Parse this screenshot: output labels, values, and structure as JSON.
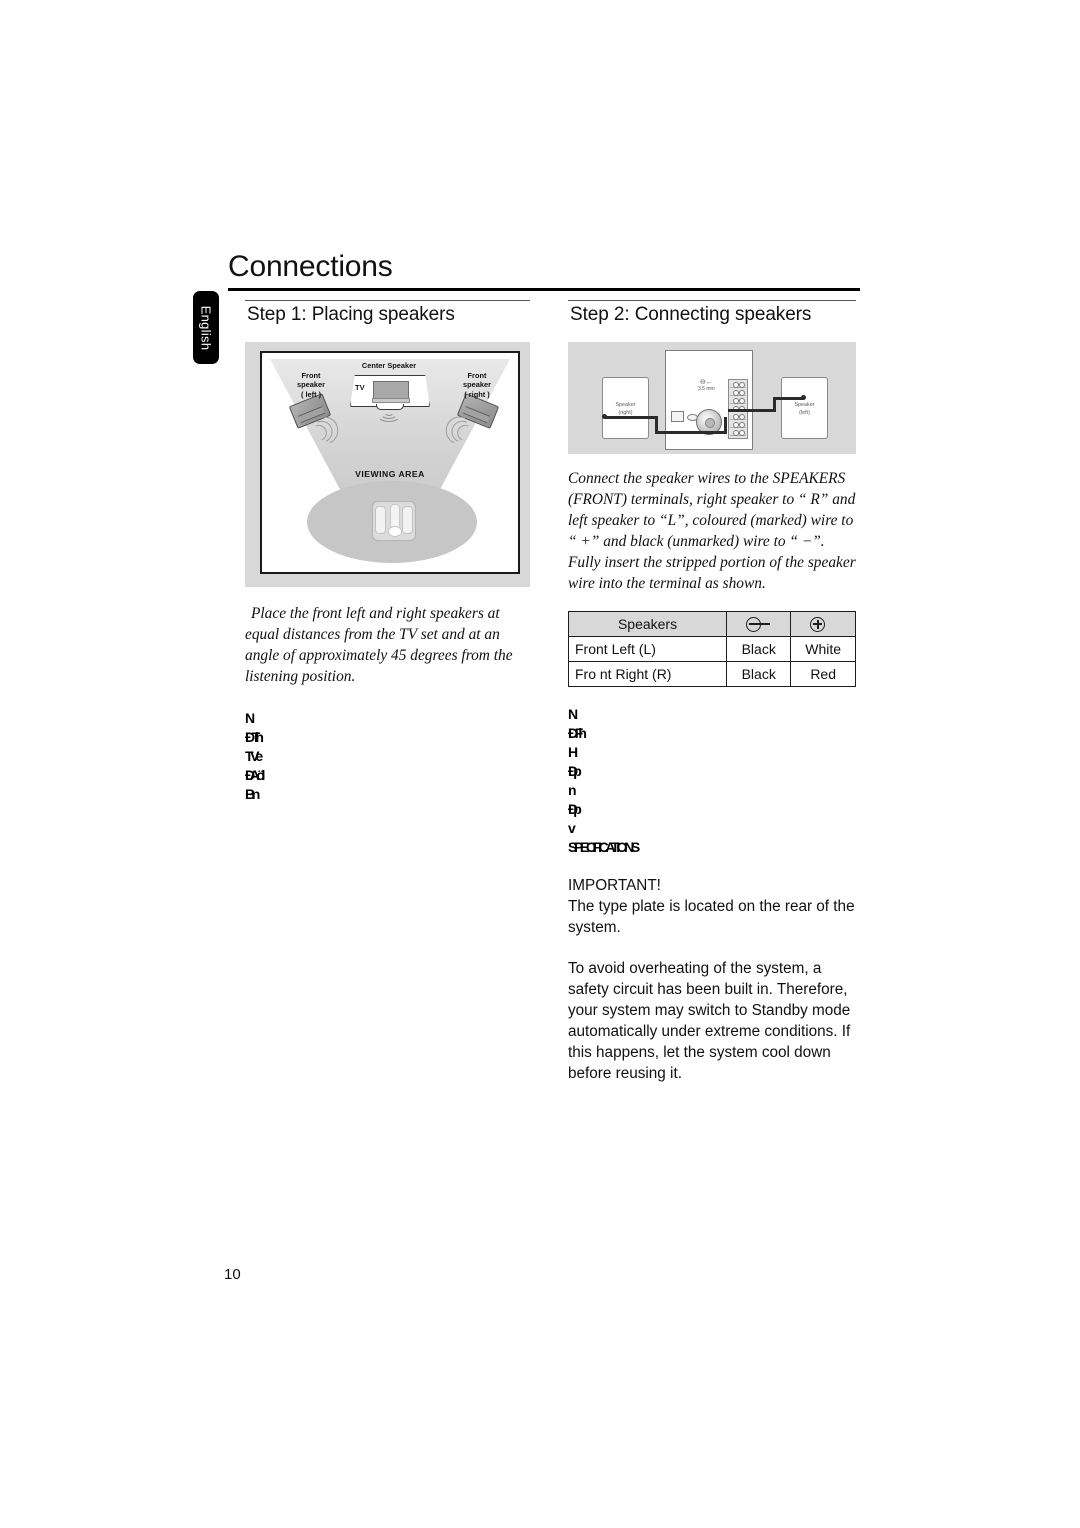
{
  "page": {
    "title": "Connections",
    "language_tab": "English",
    "page_number": "10"
  },
  "step1": {
    "heading": "Step 1:  Placing speakers",
    "illustration": {
      "labels": {
        "center_speaker": "Center Speaker",
        "front_left": "Front\nspeaker\n( left )",
        "front_left_line1": "Front",
        "front_left_line2": "speaker",
        "front_left_line3": "( left )",
        "front_right_line1": "Front",
        "front_right_line2": "speaker",
        "front_right_line3": "( right )",
        "tv": "TV",
        "viewing_area": "VIEWING AREA"
      }
    },
    "paragraph": "Place the front left and right speakers at equal distances from the TV set and at an angle of approximately 45 degrees from the listening position.",
    "garbled_lines": [
      "N",
      "ÐT h",
      "TVe",
      "Ð Aöl",
      "Bn"
    ]
  },
  "step2": {
    "heading": "Step 2:  Connecting speakers",
    "illustration": {
      "labels": {
        "speaker_right_line1": "Speaker",
        "speaker_right_line2": "(right)",
        "speaker_left_line1": "Speaker",
        "speaker_left_line2": "(left)",
        "jack_mark": "⊖←",
        "jack_caption": "3.5 mm"
      }
    },
    "paragraph": "Connect the speaker wires to the SPEAKERS (FRONT) terminals, right speaker to “  R” and left speaker to “L”, coloured (marked) wire to “  +” and black (unmarked) wire to “ −”. Fully insert the stripped portion of the speaker wire into the terminal as shown.",
    "table": {
      "headers": {
        "name": "Speakers",
        "negative_icon": "minus-in-circle-icon",
        "positive_icon": "plus-in-circle-icon"
      },
      "rows": [
        {
          "name": "Front Left (L)",
          "negative": "Black",
          "positive": "White"
        },
        {
          "name": "Fro nt Right (R)",
          "negative": "Black",
          "positive": "Red"
        }
      ]
    },
    "garbled_lines": [
      "N",
      "ÐF h",
      "H",
      "Ð p",
      "n",
      "Ð p",
      "v",
      "SPECIFICATIONS"
    ],
    "important": {
      "label": "IMPORTANT!",
      "paragraph1": "The type plate is located on the rear of the system.",
      "paragraph2": "To  avoid overheating of the system, a safety circuit has been built in. Therefore, your system may switch to Standby mode automatically under extreme conditions.  If this happens, let the system cool down before reusing it."
    }
  },
  "colors": {
    "illustration_background": "#d8d8d8",
    "table_header_background": "#d8d8d8",
    "tab_background": "#000000",
    "text": "#111111",
    "wire": "#2b2b2b"
  }
}
